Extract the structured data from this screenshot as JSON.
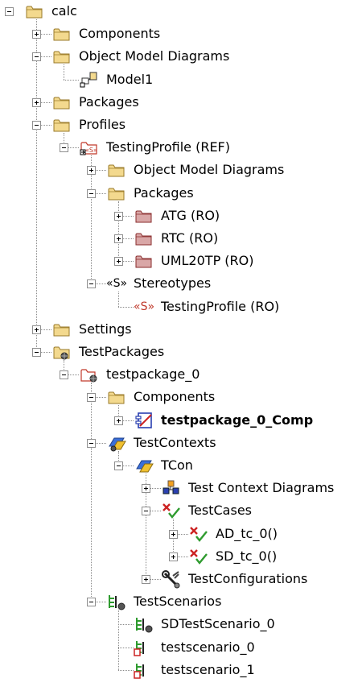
{
  "tree": [
    {
      "label": "calc",
      "level": 0,
      "expander": "minus",
      "icon": "folder-icon"
    },
    {
      "label": "Components",
      "level": 1,
      "expander": "plus",
      "icon": "folder-icon"
    },
    {
      "label": "Object Model Diagrams",
      "level": 1,
      "expander": "minus",
      "icon": "folder-icon"
    },
    {
      "label": "Model1",
      "level": 2,
      "expander": "none",
      "icon": "object-model-diagram-icon"
    },
    {
      "label": "Packages",
      "level": 1,
      "expander": "plus",
      "icon": "folder-icon"
    },
    {
      "label": "Profiles",
      "level": 1,
      "expander": "minus",
      "icon": "folder-icon"
    },
    {
      "label": "TestingProfile (REF)",
      "level": 2,
      "expander": "minus",
      "icon": "profile-ref-icon"
    },
    {
      "label": "Object Model Diagrams",
      "level": 3,
      "expander": "plus",
      "icon": "folder-icon"
    },
    {
      "label": "Packages",
      "level": 3,
      "expander": "minus",
      "icon": "folder-icon"
    },
    {
      "label": "ATG (RO)",
      "level": 4,
      "expander": "plus",
      "icon": "readonly-package-icon"
    },
    {
      "label": "RTC (RO)",
      "level": 4,
      "expander": "plus",
      "icon": "readonly-package-icon"
    },
    {
      "label": "UML20TP (RO)",
      "level": 4,
      "expander": "plus",
      "icon": "readonly-package-icon"
    },
    {
      "label": "Stereotypes",
      "level": 3,
      "expander": "minus",
      "icon": "stereotypes-icon"
    },
    {
      "label": "TestingProfile (RO)",
      "level": 4,
      "expander": "none",
      "icon": "stereotype-readonly-icon"
    },
    {
      "label": "Settings",
      "level": 1,
      "expander": "plus",
      "icon": "folder-icon"
    },
    {
      "label": "TestPackages",
      "level": 1,
      "expander": "minus",
      "icon": "test-packages-folder-icon"
    },
    {
      "label": "testpackage_0",
      "level": 2,
      "expander": "minus",
      "icon": "test-package-icon"
    },
    {
      "label": "Components",
      "level": 3,
      "expander": "minus",
      "icon": "folder-icon"
    },
    {
      "label": "testpackage_0_Comp",
      "level": 4,
      "expander": "plus",
      "icon": "component-icon",
      "bold": true
    },
    {
      "label": "TestContexts",
      "level": 3,
      "expander": "minus",
      "icon": "test-contexts-icon"
    },
    {
      "label": "TCon",
      "level": 4,
      "expander": "minus",
      "icon": "test-context-icon"
    },
    {
      "label": "Test Context Diagrams",
      "level": 5,
      "expander": "plus",
      "icon": "test-context-diagram-icon"
    },
    {
      "label": "TestCases",
      "level": 5,
      "expander": "minus",
      "icon": "test-cases-icon"
    },
    {
      "label": "AD_tc_0()",
      "level": 6,
      "expander": "plus",
      "icon": "test-case-icon"
    },
    {
      "label": "SD_tc_0()",
      "level": 6,
      "expander": "plus",
      "icon": "test-case-icon"
    },
    {
      "label": "TestConfigurations",
      "level": 5,
      "expander": "plus",
      "icon": "test-configurations-icon"
    },
    {
      "label": "TestScenarios",
      "level": 3,
      "expander": "minus",
      "icon": "test-scenarios-icon"
    },
    {
      "label": "SDTestScenario_0",
      "level": 4,
      "expander": "none",
      "icon": "sd-test-scenario-icon"
    },
    {
      "label": "testscenario_0",
      "level": 4,
      "expander": "none",
      "icon": "test-scenario-icon"
    },
    {
      "label": "testscenario_1",
      "level": 4,
      "expander": "none",
      "icon": "test-scenario-icon"
    }
  ],
  "stereotype_glyph": "«S»",
  "colors": {
    "folder_fill": "#f3d98e",
    "folder_stroke": "#9a7a2a",
    "readonly_package_fill": "#d9a7a7",
    "readonly_package_stroke": "#8a2c2c",
    "stereotype_glyph_color": "#c0392b",
    "test_case_red": "#cc2222",
    "test_case_green": "#2f9b2f",
    "component_blue": "#2a3fb0",
    "tree_line": "#8a8a8a"
  }
}
